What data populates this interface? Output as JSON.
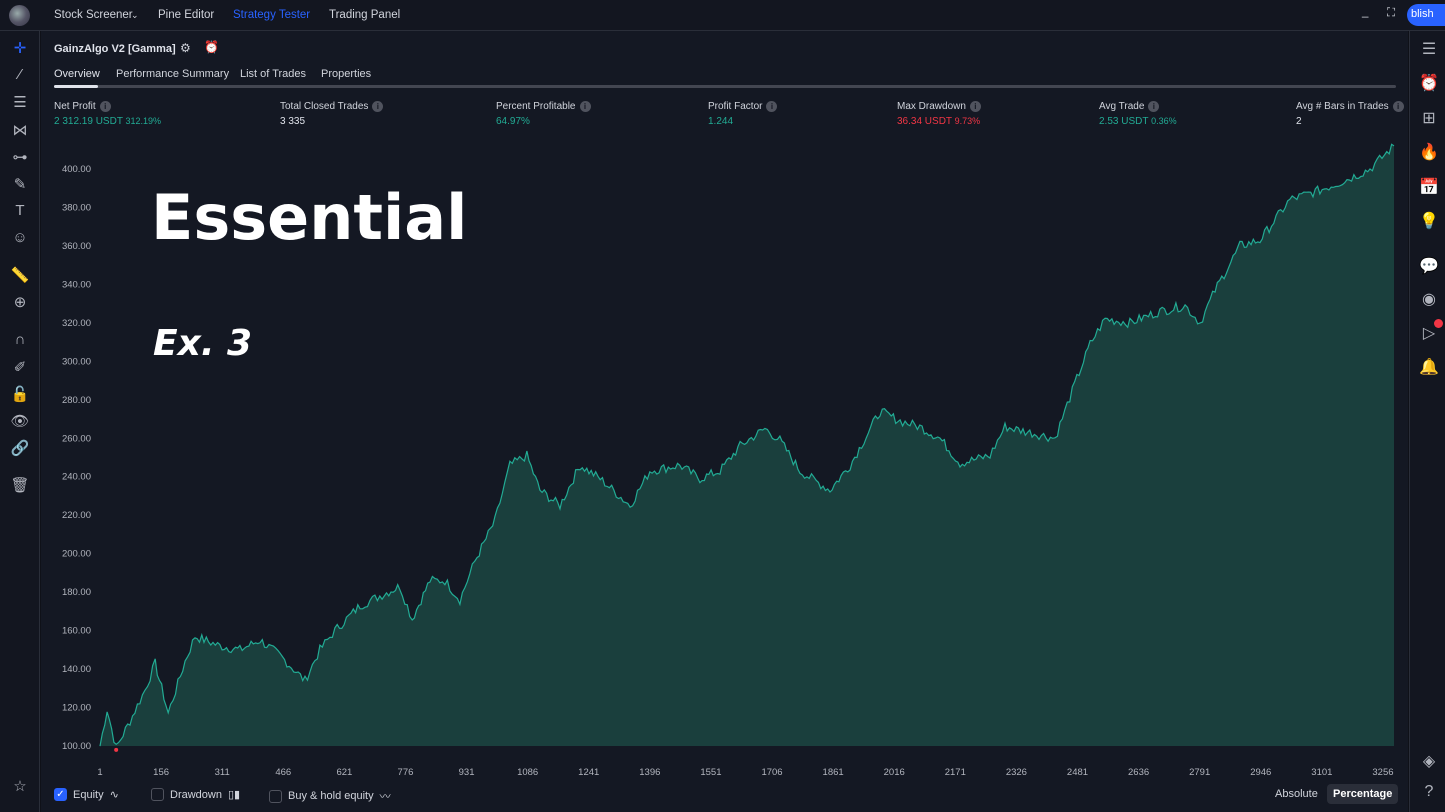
{
  "topbar": {
    "tabs": [
      "Stock Screener",
      "Pine Editor",
      "Strategy Tester",
      "Trading Panel"
    ],
    "active": "Strategy Tester",
    "publish": "blish"
  },
  "strategy": {
    "name": "GainzAlgo V2 [Gamma]"
  },
  "tabs": [
    "Overview",
    "Performance Summary",
    "List of Trades",
    "Properties"
  ],
  "stats": [
    {
      "label": "Net Profit",
      "value": "2 312.19 USDT",
      "pct": "312.19%",
      "color": "green"
    },
    {
      "label": "Total Closed Trades",
      "value": "3 335",
      "pct": "",
      "color": "white"
    },
    {
      "label": "Percent Profitable",
      "value": "64.97%",
      "pct": "",
      "color": "green"
    },
    {
      "label": "Profit Factor",
      "value": "1.244",
      "pct": "",
      "color": "green"
    },
    {
      "label": "Max Drawdown",
      "value": "36.34 USDT",
      "pct": "9.73%",
      "color": "red"
    },
    {
      "label": "Avg Trade",
      "value": "2.53 USDT",
      "pct": "0.36%",
      "color": "green"
    },
    {
      "label": "Avg # Bars in Trades",
      "value": "2",
      "pct": "",
      "color": "white"
    }
  ],
  "overlay": {
    "title": "Essential",
    "subtitle": "Ex. 3"
  },
  "footer": {
    "equity": "Equity",
    "drawdown": "Drawdown",
    "buyhold": "Buy & hold equity",
    "absolute": "Absolute",
    "percentage": "Percentage",
    "equity_checked": true
  },
  "colors": {
    "line": "#22ab94",
    "fill": "#1b4a44",
    "accent": "#2962ff",
    "red": "#f23645"
  },
  "chart_data": {
    "type": "area",
    "x_ticks": [
      "1",
      "156",
      "311",
      "466",
      "621",
      "776",
      "931",
      "1086",
      "1241",
      "1396",
      "1551",
      "1706",
      "1861",
      "2016",
      "2171",
      "2326",
      "2481",
      "2636",
      "2791",
      "2946",
      "3101",
      "3256"
    ],
    "y_ticks": [
      "100.00",
      "120.00",
      "140.00",
      "160.00",
      "180.00",
      "200.00",
      "220.00",
      "240.00",
      "260.00",
      "280.00",
      "300.00",
      "320.00",
      "340.00",
      "360.00",
      "380.00",
      "400.00"
    ],
    "ylim": [
      100,
      412
    ],
    "xlim": [
      1,
      3284
    ],
    "series": [
      {
        "values": [
          [
            1,
            100
          ],
          [
            19,
            119
          ],
          [
            42,
            99
          ],
          [
            77,
            113
          ],
          [
            115,
            129
          ],
          [
            141,
            143
          ],
          [
            174,
            117
          ],
          [
            217,
            144
          ],
          [
            242,
            157
          ],
          [
            305,
            152
          ],
          [
            356,
            150
          ],
          [
            407,
            155
          ],
          [
            458,
            147
          ],
          [
            521,
            134
          ],
          [
            559,
            150
          ],
          [
            597,
            160
          ],
          [
            661,
            173
          ],
          [
            711,
            178
          ],
          [
            762,
            183
          ],
          [
            793,
            166
          ],
          [
            838,
            186
          ],
          [
            876,
            186
          ],
          [
            914,
            176
          ],
          [
            952,
            196
          ],
          [
            1003,
            217
          ],
          [
            1041,
            246
          ],
          [
            1084,
            251
          ],
          [
            1117,
            233
          ],
          [
            1168,
            225
          ],
          [
            1219,
            246
          ],
          [
            1270,
            239
          ],
          [
            1346,
            225
          ],
          [
            1396,
            243
          ],
          [
            1472,
            246
          ],
          [
            1523,
            239
          ],
          [
            1574,
            243
          ],
          [
            1625,
            256
          ],
          [
            1688,
            265
          ],
          [
            1726,
            259
          ],
          [
            1777,
            243
          ],
          [
            1853,
            233
          ],
          [
            1904,
            246
          ],
          [
            1980,
            274
          ],
          [
            2031,
            269
          ],
          [
            2081,
            266
          ],
          [
            2132,
            260
          ],
          [
            2183,
            247
          ],
          [
            2259,
            251
          ],
          [
            2297,
            266
          ],
          [
            2360,
            263
          ],
          [
            2424,
            260
          ],
          [
            2474,
            288
          ],
          [
            2513,
            309
          ],
          [
            2551,
            322
          ],
          [
            2614,
            320
          ],
          [
            2690,
            326
          ],
          [
            2754,
            329
          ],
          [
            2792,
            320
          ],
          [
            2830,
            337
          ],
          [
            2893,
            360
          ],
          [
            2944,
            363
          ],
          [
            3020,
            384
          ],
          [
            3096,
            389
          ],
          [
            3159,
            394
          ],
          [
            3223,
            400
          ],
          [
            3284,
            412
          ]
        ]
      }
    ]
  }
}
